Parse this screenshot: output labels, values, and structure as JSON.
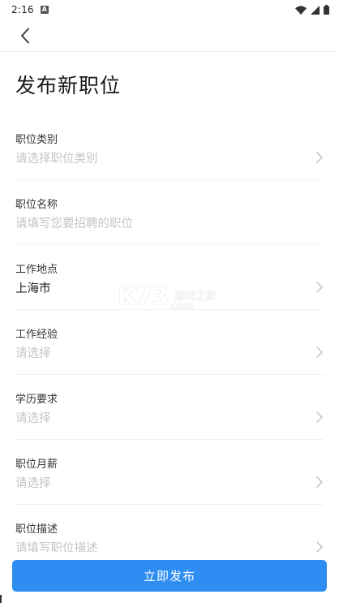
{
  "status_bar": {
    "time": "2:16",
    "notification_icon": "a-letter-icon",
    "icons": [
      "wifi-icon",
      "signal-icon",
      "battery-icon"
    ]
  },
  "top_bar": {
    "back_icon": "chevron-left-icon"
  },
  "page": {
    "title": "发布新职位"
  },
  "form": {
    "rows": [
      {
        "label": "职位类别",
        "value": "请选择职位类别",
        "filled": false
      },
      {
        "label": "职位名称",
        "value": "请填写您要招聘的职位",
        "filled": false
      },
      {
        "label": "工作地点",
        "value": "上海市",
        "filled": true
      },
      {
        "label": "工作经验",
        "value": "请选择",
        "filled": false
      },
      {
        "label": "学历要求",
        "value": "请选择",
        "filled": false
      },
      {
        "label": "职位月薪",
        "value": "请选择",
        "filled": false
      },
      {
        "label": "职位描述",
        "value": "请填写职位描述",
        "filled": false
      }
    ]
  },
  "watermark": {
    "big": "K73",
    "small": "游戏之家",
    "suffix": ".com"
  },
  "footer": {
    "publish_label": "立即发布"
  },
  "colors": {
    "accent": "#2e8df2",
    "placeholder": "#c4c4c4",
    "divider": "#f0f0f0"
  }
}
